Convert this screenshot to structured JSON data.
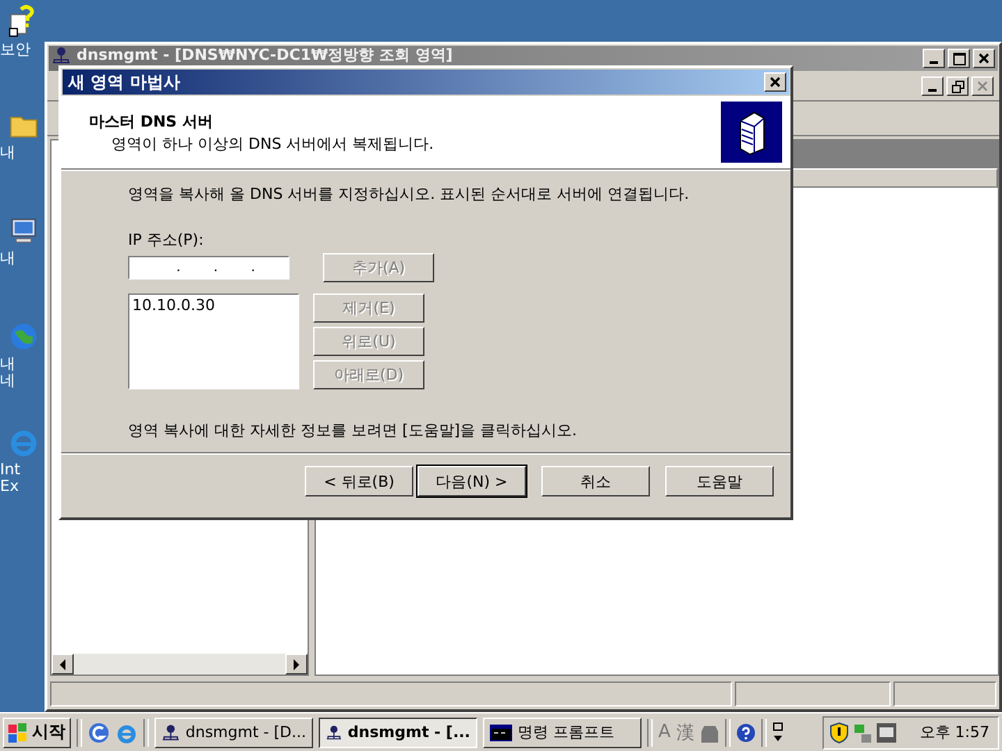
{
  "desktop": {
    "icons": [
      {
        "label": "보안",
        "kind": "help"
      },
      {
        "label": "내",
        "kind": "folder"
      },
      {
        "label": "내",
        "kind": "computer"
      },
      {
        "label": "내 네",
        "kind": "network"
      },
      {
        "label": "Int Ex",
        "kind": "browser"
      }
    ]
  },
  "mmc": {
    "title": "dnsmgmt - [DNS₩NYC-DC1₩정방향 조회 영역]",
    "active": false
  },
  "wizard": {
    "title": "새 영역 마법사",
    "active": true,
    "header_title": "마스터 DNS 서버",
    "header_subtitle": "영역이 하나 이상의 DNS 서버에서 복제됩니다.",
    "instruction": "영역을 복사해 올 DNS 서버를 지정하십시오. 표시된 순서대로 서버에 연결됩니다.",
    "ip_label": "IP 주소(P):",
    "ip_separator": ".",
    "add_button": {
      "label": "추가(A)",
      "disabled": true
    },
    "servers": [
      {
        "address": "10.10.0.30",
        "selected": false
      }
    ],
    "list_buttons": [
      {
        "label": "제거(E)",
        "disabled": true
      },
      {
        "label": "위로(U)",
        "disabled": true
      },
      {
        "label": "아래로(D)",
        "disabled": true
      }
    ],
    "help_text": "영역 복사에 대한 자세한 정보를 보려면 [도움말]을 클릭하십시오.",
    "buttons": [
      {
        "label": "< 뒤로(B)",
        "default": false
      },
      {
        "label": "다음(N) >",
        "default": true
      },
      {
        "label": "취소",
        "default": false
      },
      {
        "label": "도움말",
        "default": false
      }
    ]
  },
  "taskbar": {
    "start_label": "시작",
    "tasks": [
      {
        "label": "dnsmgmt - [D...",
        "kind": "mmc",
        "selected": false
      },
      {
        "label": "dnsmgmt - [...",
        "kind": "mmc",
        "selected": true
      },
      {
        "label": "명령 프롬프트",
        "kind": "console",
        "selected": false
      }
    ],
    "language_bar": [
      "A",
      "漢"
    ],
    "clock": "오후 1:57"
  }
}
